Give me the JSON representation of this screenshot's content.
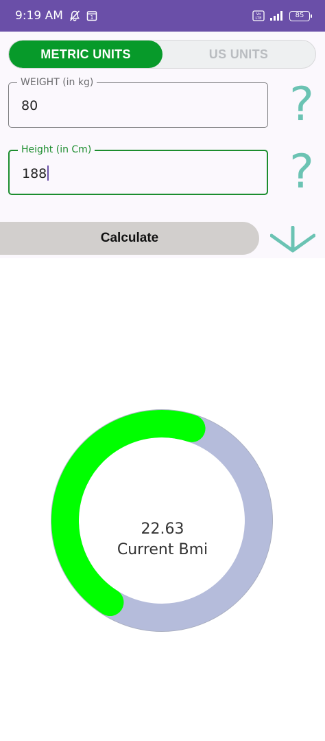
{
  "status_bar": {
    "time": "9:19 AM",
    "notification_icon": "bell-off-icon",
    "calendar_badge": "1",
    "volte_label": "Vo LTE",
    "battery_level": "85"
  },
  "unit_toggle": {
    "metric_label": "METRIC UNITS",
    "us_label": "US UNITS",
    "selected": "metric"
  },
  "weight_field": {
    "label": "WEIGHT (in kg)",
    "value": "80"
  },
  "height_field": {
    "label": "Height (in Cm)",
    "value": "188"
  },
  "help_icon": "?",
  "calculate_label": "Calculate",
  "bmi": {
    "value": "22.63",
    "caption": "Current Bmi",
    "progress_fraction": 0.46
  },
  "colors": {
    "status_bar": "#6a4fa8",
    "accent_green": "#079a2a",
    "progress_green": "#00ff00",
    "track": "#b5bcdb",
    "help_teal": "#6bc3b3"
  }
}
